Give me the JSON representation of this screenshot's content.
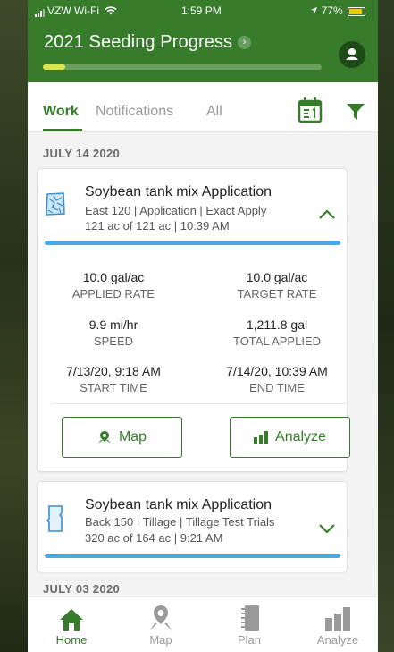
{
  "status_bar": {
    "carrier": "VZW Wi-Fi",
    "time": "1:59 PM",
    "battery": "77%"
  },
  "header": {
    "title": "2021 Seeding Progress",
    "progress_fraction": 0.08
  },
  "tabs": [
    {
      "label": "Work",
      "active": true
    },
    {
      "label": "Notifications",
      "active": false
    },
    {
      "label": "All",
      "active": false
    }
  ],
  "sections": [
    {
      "date": "JULY 14 2020",
      "card": {
        "title": "Soybean tank mix Application",
        "subtitle": "East 120 | Application | Exact Apply",
        "meta": "121 ac of 121 ac | 10:39 AM",
        "expanded": true,
        "metrics": [
          {
            "value": "10.0 gal/ac",
            "label": "APPLIED RATE"
          },
          {
            "value": "10.0 gal/ac",
            "label": "TARGET RATE"
          },
          {
            "value": "9.9 mi/hr",
            "label": "SPEED"
          },
          {
            "value": "1,211.8 gal",
            "label": "TOTAL APPLIED"
          },
          {
            "value": "7/13/20, 9:18 AM",
            "label": "START TIME"
          },
          {
            "value": "7/14/20, 10:39 AM",
            "label": "END TIME"
          }
        ],
        "buttons": {
          "map": "Map",
          "analyze": "Analyze"
        }
      }
    },
    {
      "card": {
        "title": "Soybean tank mix Application",
        "subtitle": "Back 150 | Tillage | Tillage Test Trials",
        "meta": "320 ac of 164 ac | 9:21 AM",
        "expanded": false
      }
    },
    {
      "date": "JULY 03 2020"
    }
  ],
  "bottom_nav": [
    {
      "label": "Home",
      "icon": "home-icon",
      "active": true
    },
    {
      "label": "Map",
      "icon": "map-pin-icon",
      "active": false
    },
    {
      "label": "Plan",
      "icon": "notebook-icon",
      "active": false
    },
    {
      "label": "Analyze",
      "icon": "bar-chart-icon",
      "active": false
    }
  ],
  "colors": {
    "brand_green": "#367c2b",
    "progress_yellow": "#d7e651",
    "card_bar_blue": "#4aa9e0"
  }
}
